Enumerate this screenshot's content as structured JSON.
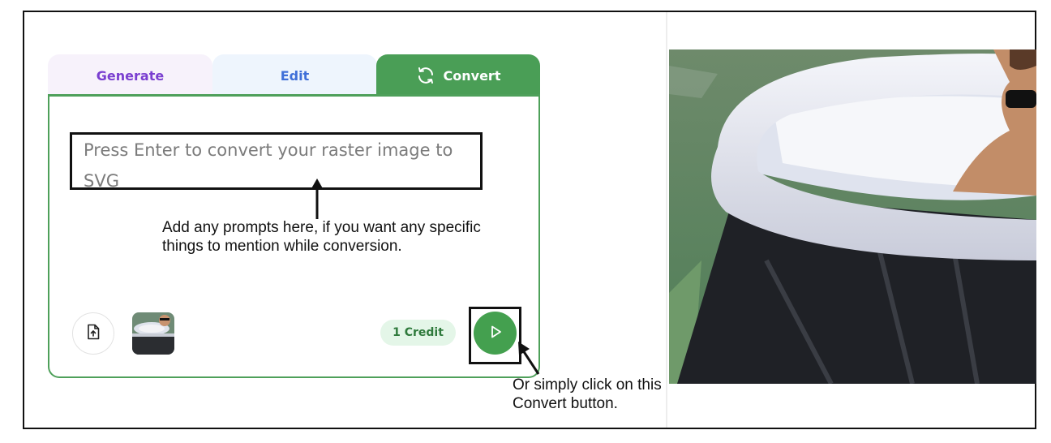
{
  "tabs": [
    {
      "label": "Generate",
      "active": false
    },
    {
      "label": "Edit",
      "active": false
    },
    {
      "label": "Convert",
      "active": true,
      "icon": "refresh-icon"
    }
  ],
  "prompt": {
    "placeholder": "Press Enter to convert your raster image to SVG"
  },
  "annotations": {
    "prompt_hint": "Add any prompts here, if you want any specific things to mention while conversion.",
    "convert_hint": "Or simply click on this Convert button."
  },
  "toolbar": {
    "upload_icon": "file-upload-icon",
    "thumbnail_icon": "uploaded-image-thumbnail",
    "credit_label": "1 Credit",
    "convert_icon": "play-icon"
  },
  "colors": {
    "convert_green": "#4a9e56",
    "generate_purple": "#7a3fd0",
    "edit_blue": "#3f6fd8",
    "credit_bg": "#e4f6e8"
  }
}
